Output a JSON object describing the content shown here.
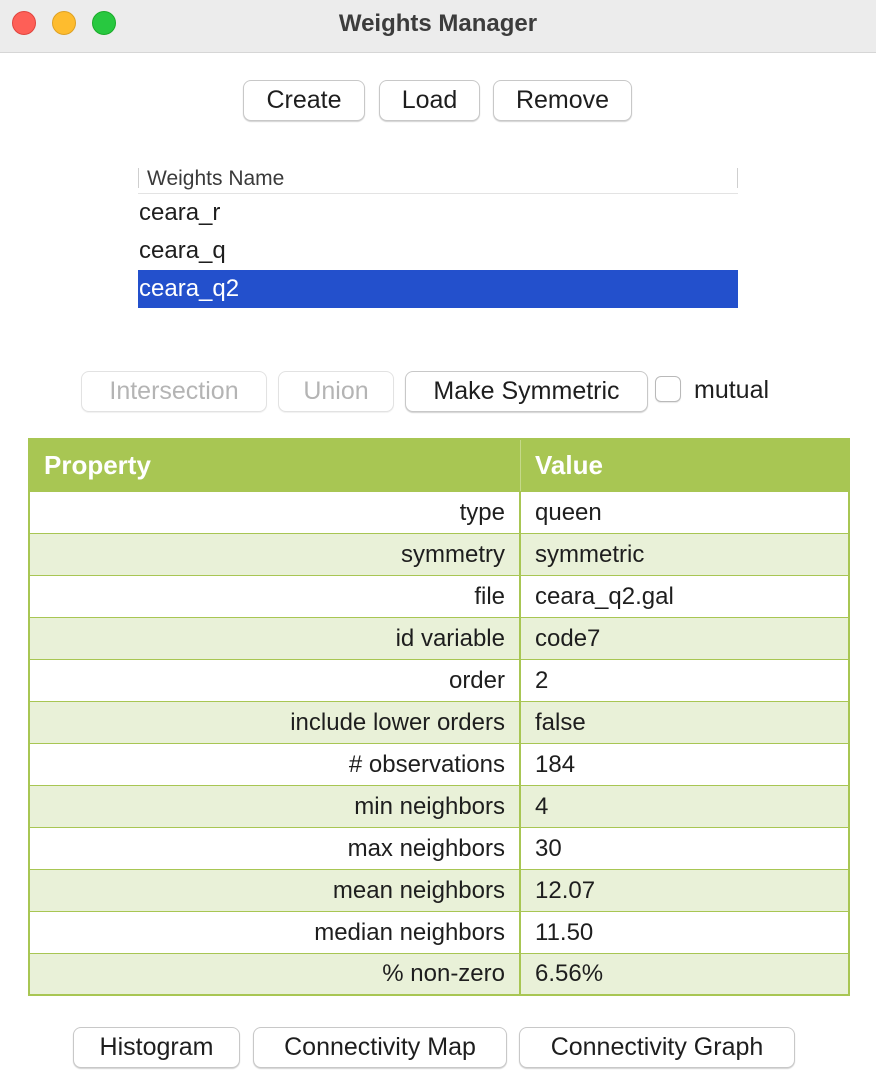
{
  "window": {
    "title": "Weights Manager"
  },
  "toolbar": {
    "create": "Create",
    "load": "Load",
    "remove": "Remove"
  },
  "weights_list": {
    "header": "Weights Name",
    "items": [
      "ceara_r",
      "ceara_q",
      "ceara_q2"
    ],
    "selected": "ceara_q2"
  },
  "ops": {
    "intersection": "Intersection",
    "union": "Union",
    "make_symmetric": "Make Symmetric",
    "mutual_label": "mutual",
    "mutual_checked": false
  },
  "properties": {
    "header_property": "Property",
    "header_value": "Value",
    "rows": [
      {
        "property": "type",
        "value": "queen"
      },
      {
        "property": "symmetry",
        "value": "symmetric"
      },
      {
        "property": "file",
        "value": "ceara_q2.gal"
      },
      {
        "property": "id variable",
        "value": "code7"
      },
      {
        "property": "order",
        "value": "2"
      },
      {
        "property": "include lower orders",
        "value": "false"
      },
      {
        "property": "# observations",
        "value": "184"
      },
      {
        "property": "min neighbors",
        "value": "4"
      },
      {
        "property": "max neighbors",
        "value": "30"
      },
      {
        "property": "mean neighbors",
        "value": "12.07"
      },
      {
        "property": "median neighbors",
        "value": "11.50"
      },
      {
        "property": "% non-zero",
        "value": "6.56%"
      }
    ]
  },
  "bottom": {
    "histogram": "Histogram",
    "connectivity_map": "Connectivity Map",
    "connectivity_graph": "Connectivity Graph"
  },
  "colors": {
    "table_accent": "#a8c653",
    "table_alt_row": "#e9f1d8",
    "selection": "#2350cc"
  }
}
